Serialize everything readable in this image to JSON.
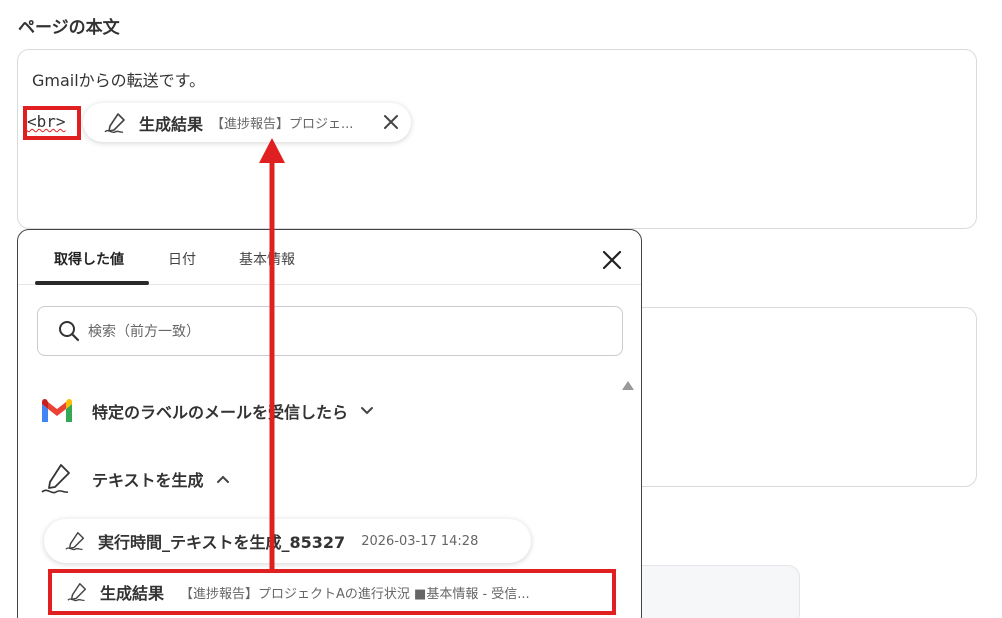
{
  "section": {
    "title": "ページの本文"
  },
  "editor": {
    "text": "Gmailからの転送です。",
    "br_token": "<br>",
    "chip": {
      "label": "生成結果",
      "value": "【進捗報告】プロジェ..."
    }
  },
  "popup": {
    "tabs": [
      {
        "label": "取得した値"
      },
      {
        "label": "日付"
      },
      {
        "label": "基本情報"
      }
    ],
    "search_placeholder": "検索（前方一致）",
    "groups": [
      {
        "label": "特定のラベルのメールを受信したら"
      },
      {
        "label": "テキストを生成"
      }
    ],
    "items": [
      {
        "label": "実行時間_テキストを生成_85327",
        "value": "2026-03-17 14:28"
      },
      {
        "label": "生成結果",
        "value": "【進捗報告】プロジェクトAの進行状況 ■基本情報 - 受信..."
      }
    ]
  },
  "colors": {
    "highlight": "#e02020",
    "text": "#333333",
    "border": "#d9dadf"
  }
}
